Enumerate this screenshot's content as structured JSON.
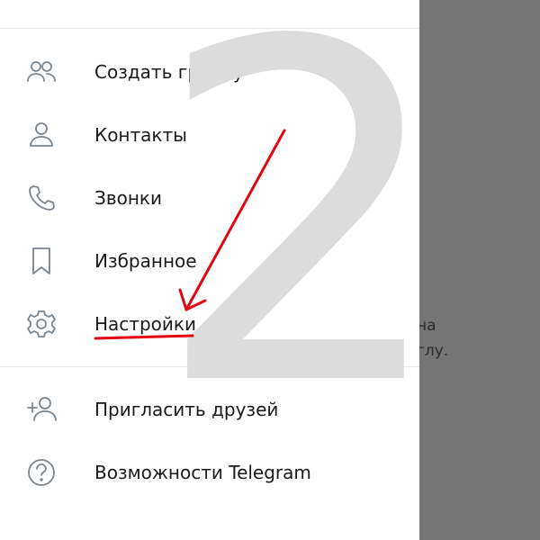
{
  "backdrop": {
    "line1": "на",
    "line2": "глу."
  },
  "overlay": {
    "big_digit": "2",
    "arrow_color": "#e30613"
  },
  "menu": {
    "items": [
      {
        "label": "Создать группу",
        "icon": "group-icon"
      },
      {
        "label": "Контакты",
        "icon": "contact-icon"
      },
      {
        "label": "Звонки",
        "icon": "phone-icon"
      },
      {
        "label": "Избранное",
        "icon": "bookmark-icon"
      },
      {
        "label": "Настройки",
        "icon": "gear-icon"
      },
      {
        "label": "Пригласить друзей",
        "icon": "add-user-icon"
      },
      {
        "label": "Возможности Telegram",
        "icon": "help-icon"
      }
    ]
  },
  "colors": {
    "drawer_bg": "#ffffff",
    "backdrop": "#757575",
    "icon": "#7b858f",
    "text": "#1a1a1a"
  }
}
